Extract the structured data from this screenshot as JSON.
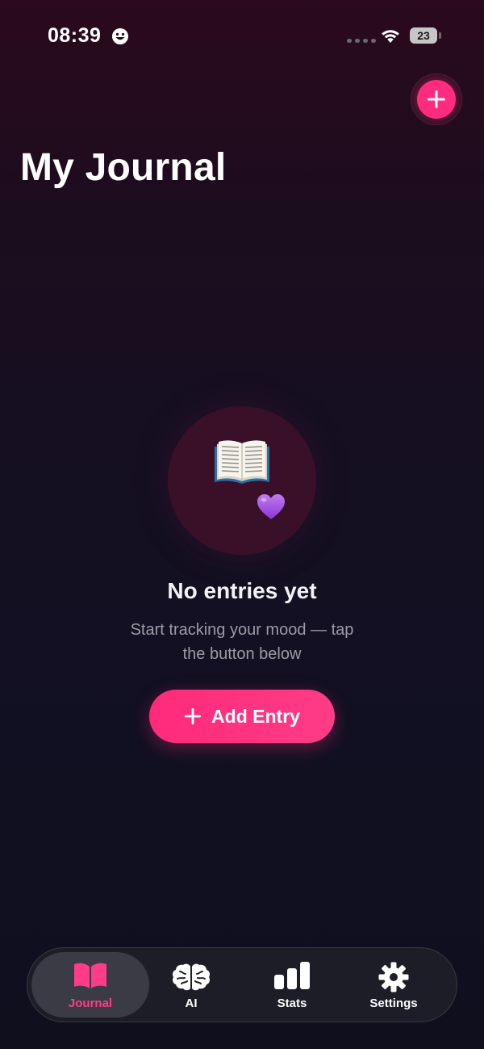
{
  "status_bar": {
    "time": "08:39",
    "battery": "23"
  },
  "header": {
    "title": "My Journal"
  },
  "empty_state": {
    "title": "No entries yet",
    "subtitle": "Start tracking your mood — tap the button below",
    "button_label": "Add Entry"
  },
  "tab_bar": {
    "items": [
      {
        "label": "Journal",
        "icon": "book-icon",
        "active": true
      },
      {
        "label": "AI",
        "icon": "brain-icon",
        "active": false
      },
      {
        "label": "Stats",
        "icon": "bar-chart-icon",
        "active": false
      },
      {
        "label": "Settings",
        "icon": "gear-icon",
        "active": false
      }
    ]
  },
  "colors": {
    "accent": "#ff2b7f",
    "background_top": "#2a0a1c",
    "background_bottom": "#0f0f1e",
    "tab_active_bg": "#3b3b46",
    "muted_text": "#9e9aa6"
  }
}
